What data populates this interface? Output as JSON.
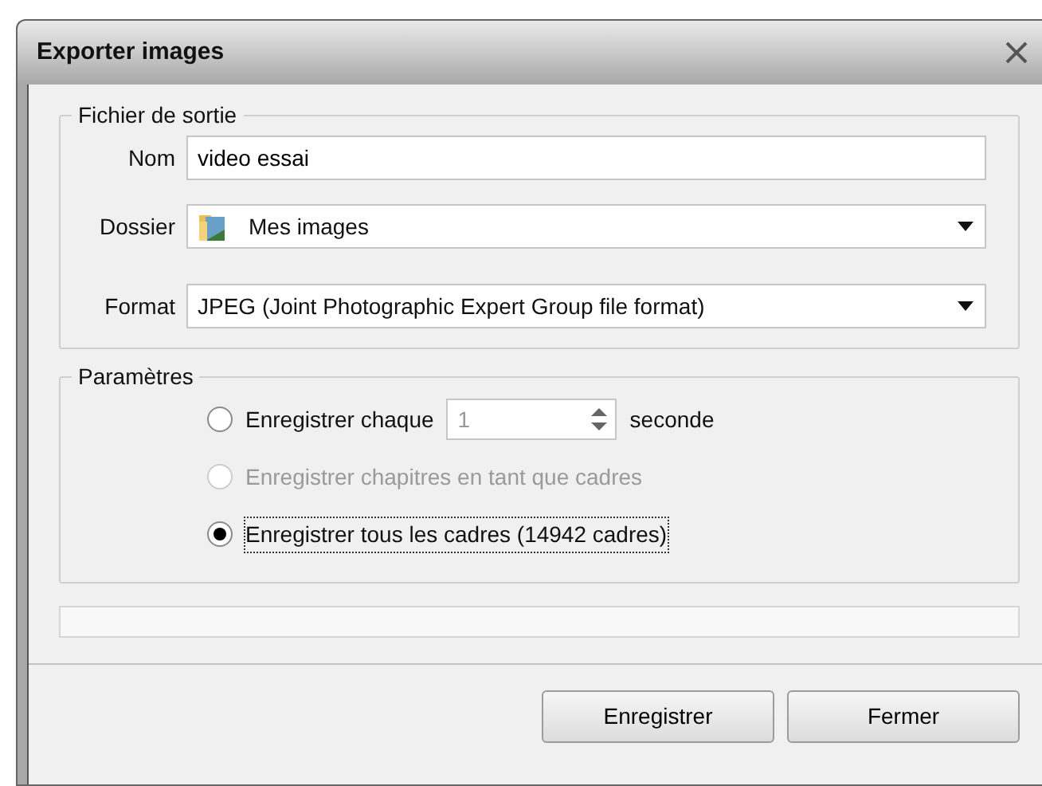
{
  "window": {
    "title": "Exporter images"
  },
  "output_group": {
    "legend": "Fichier de sortie",
    "fields": [
      {
        "kind": "text",
        "label": "Nom",
        "value": "video essai"
      },
      {
        "kind": "folder",
        "label": "Dossier",
        "value": "Mes images"
      },
      {
        "kind": "select",
        "label": "Format",
        "value": "JPEG (Joint Photographic Expert Group file format)"
      }
    ]
  },
  "params_group": {
    "legend": "Paramètres",
    "options": [
      {
        "label": "Enregistrer chaque",
        "selected": false,
        "disabled": false,
        "focused": false,
        "spinner": {
          "value": "1",
          "disabled": true
        },
        "suffix": "seconde"
      },
      {
        "label": "Enregistrer chapitres en tant que cadres",
        "selected": false,
        "disabled": true,
        "focused": false
      },
      {
        "label": "Enregistrer tous les cadres (14942 cadres)",
        "selected": true,
        "disabled": false,
        "focused": true
      }
    ]
  },
  "progress": {
    "level": 0
  },
  "buttons": [
    "Enregistrer",
    "Fermer"
  ]
}
